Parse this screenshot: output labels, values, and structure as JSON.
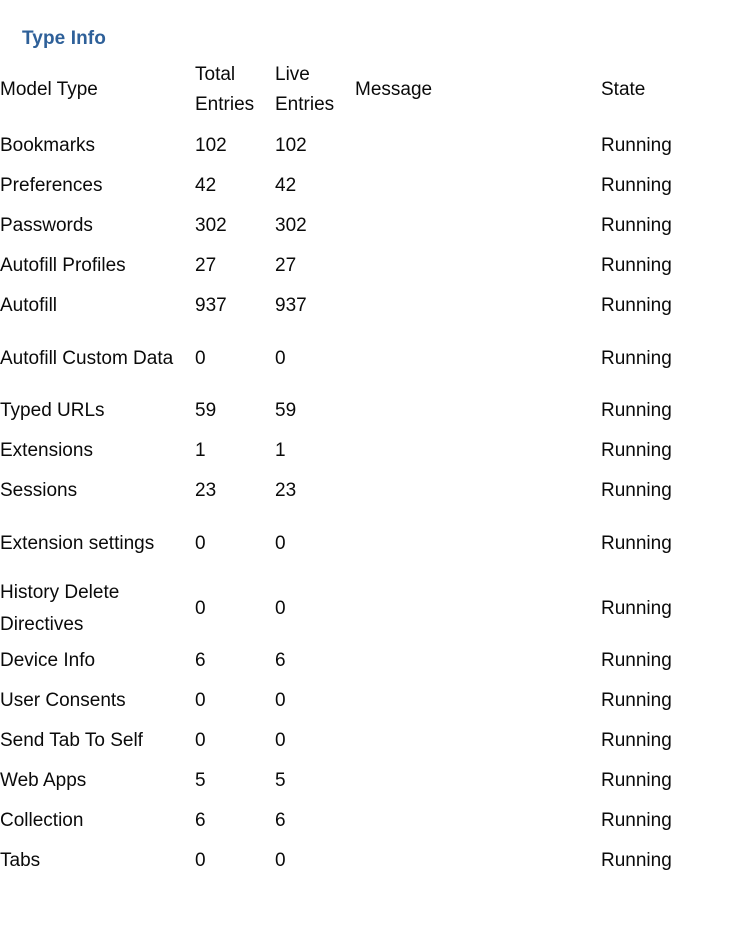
{
  "section": {
    "title": "Type Info",
    "title_color": "#2E6099"
  },
  "table": {
    "columns": [
      {
        "key": "model_type",
        "label": "Model Type"
      },
      {
        "key": "total_entries",
        "label": "Total Entries"
      },
      {
        "key": "live_entries",
        "label": "Live Entries"
      },
      {
        "key": "message",
        "label": "Message"
      },
      {
        "key": "state",
        "label": "State"
      }
    ],
    "column_labels": {
      "model_type": "Model Type",
      "total_entries_line1": "Total",
      "total_entries_line2": "Entries",
      "live_entries_line1": "Live",
      "live_entries_line2": "Entries",
      "message": "Message",
      "state": "State"
    },
    "rows": [
      {
        "model_type": "Bookmarks",
        "total_entries": "102",
        "live_entries": "102",
        "message": "",
        "state": "Running"
      },
      {
        "model_type": "Preferences",
        "total_entries": "42",
        "live_entries": "42",
        "message": "",
        "state": "Running"
      },
      {
        "model_type": "Passwords",
        "total_entries": "302",
        "live_entries": "302",
        "message": "",
        "state": "Running"
      },
      {
        "model_type": "Autofill Profiles",
        "total_entries": "27",
        "live_entries": "27",
        "message": "",
        "state": "Running"
      },
      {
        "model_type": "Autofill",
        "total_entries": "937",
        "live_entries": "937",
        "message": "",
        "state": "Running"
      },
      {
        "model_type": "Autofill Custom Data",
        "total_entries": "0",
        "live_entries": "0",
        "message": "",
        "state": "Running"
      },
      {
        "model_type": "Typed URLs",
        "total_entries": "59",
        "live_entries": "59",
        "message": "",
        "state": "Running"
      },
      {
        "model_type": "Extensions",
        "total_entries": "1",
        "live_entries": "1",
        "message": "",
        "state": "Running"
      },
      {
        "model_type": "Sessions",
        "total_entries": "23",
        "live_entries": "23",
        "message": "",
        "state": "Running"
      },
      {
        "model_type": "Extension settings",
        "total_entries": "0",
        "live_entries": "0",
        "message": "",
        "state": "Running"
      },
      {
        "model_type": "History Delete Directives",
        "total_entries": "0",
        "live_entries": "0",
        "message": "",
        "state": "Running"
      },
      {
        "model_type": "Device Info",
        "total_entries": "6",
        "live_entries": "6",
        "message": "",
        "state": "Running"
      },
      {
        "model_type": "User Consents",
        "total_entries": "0",
        "live_entries": "0",
        "message": "",
        "state": "Running"
      },
      {
        "model_type": "Send Tab To Self",
        "total_entries": "0",
        "live_entries": "0",
        "message": "",
        "state": "Running"
      },
      {
        "model_type": "Web Apps",
        "total_entries": "5",
        "live_entries": "5",
        "message": "",
        "state": "Running"
      },
      {
        "model_type": "Collection",
        "total_entries": "6",
        "live_entries": "6",
        "message": "",
        "state": "Running"
      },
      {
        "model_type": "Tabs",
        "total_entries": "0",
        "live_entries": "0",
        "message": "",
        "state": "Running"
      }
    ]
  }
}
